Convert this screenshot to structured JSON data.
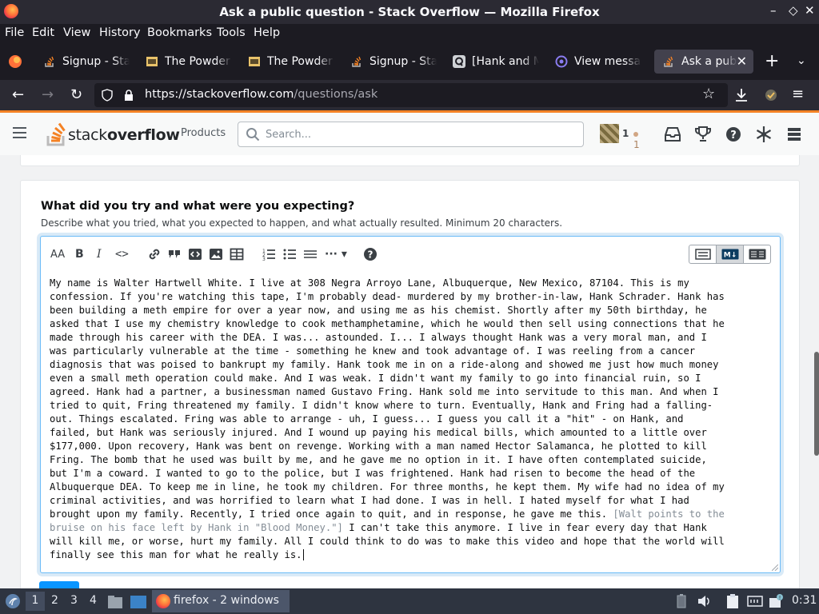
{
  "window": {
    "title": "Ask a public question - Stack Overflow — Mozilla Firefox"
  },
  "menu": [
    "File",
    "Edit",
    "View",
    "History",
    "Bookmarks",
    "Tools",
    "Help"
  ],
  "tabs": [
    {
      "label": "Signup - Stack Overflow",
      "icon": "stackoverflow-icon"
    },
    {
      "label": "The Powder Toy",
      "icon": "powder-toy-icon"
    },
    {
      "label": "The Powder Toy",
      "icon": "powder-toy-icon"
    },
    {
      "label": "Signup - Stack Overflow",
      "icon": "stackoverflow-icon"
    },
    {
      "label": "[Hank and Marie]",
      "icon": "quora-icon"
    },
    {
      "label": "View messages",
      "icon": "at-icon"
    },
    {
      "label": "Ask a public question",
      "icon": "stackoverflow-icon",
      "active": true
    }
  ],
  "nav": {
    "url_host": "https://stackoverflow.com",
    "url_path": "/questions/ask"
  },
  "so_header": {
    "logo_text_regular": "stack",
    "logo_text_bold": "overflow",
    "products": "Products",
    "search_placeholder": "Search...",
    "reputation": "1",
    "bronze_badges": "1"
  },
  "question_section": {
    "heading": "What did you try and what were you expecting?",
    "description": "Describe what you tried, what you expected to happen, and what actually resulted. Minimum 20 characters.",
    "body_lines": [
      "My name is Walter Hartwell White. I live at 308 Negra Arroyo Lane, Albuquerque, New Mexico, 87104. This is my",
      "confession. If you're watching this tape, I'm probably dead- murdered by my brother-in-law, Hank Schrader. Hank has",
      "been building a meth empire for over a year now, and using me as his chemist. Shortly after my 50th birthday, he",
      "asked that I use my chemistry knowledge to cook methamphetamine, which he would then sell using connections that he",
      "made through his career with the DEA. I was... astounded. I... I always thought Hank was a very moral man, and I",
      "was particularly vulnerable at the time - something he knew and took advantage of. I was reeling from a cancer",
      "diagnosis that was poised to bankrupt my family. Hank took me in on a ride-along and showed me just how much money",
      "even a small meth operation could make. And I was weak. I didn't want my family to go into financial ruin, so I",
      "agreed. Hank had a partner, a businessman named Gustavo Fring. Hank sold me into servitude to this man. And when I",
      "tried to quit, Fring threatened my family. I didn't know where to turn. Eventually, Hank and Fring had a falling-",
      "out. Things escalated. Fring was able to arrange - uh, I guess... I guess you call it a \"hit\" - on Hank, and",
      "failed, but Hank was seriously injured. And I wound up paying his medical bills, which amounted to a little over",
      "$177,000. Upon recovery, Hank was bent on revenge. Working with a man named Hector Salamanca, he plotted to kill",
      "Fring. The bomb that he used was built by me, and he gave me no option in it. I have often contemplated suicide,",
      "but I'm a coward. I wanted to go to the police, but I was frightened. Hank had risen to become the head of the",
      "Albuquerque DEA. To keep me in line, he took my children. For three months, he kept them. My wife had no idea of my",
      "criminal activities, and was horrified to learn what I had done. I was in hell. I hated myself for what I had",
      "brought upon my family. Recently, I tried once again to quit, and in response, he gave me this."
    ],
    "line17_dim": " [Walt points to the",
    "line18_dim": "bruise on his face left by Hank in \"Blood Money.\"]",
    "line18_rest": " I can't take this anymore. I live in fear every day that Hank",
    "line19": "will kill me, or worse, hurt my family. All I could think to do was to make this video and hope that the world will",
    "line20": "finally see this man for what he really is."
  },
  "taskbar": {
    "workspaces": [
      "1",
      "2",
      "3",
      "4"
    ],
    "task_label": "firefox - 2 windows",
    "clock": "0:31"
  },
  "colors": {
    "so_orange": "#f48225",
    "focus_blue": "#6bbbf7",
    "primary_button": "#0a95ff"
  }
}
